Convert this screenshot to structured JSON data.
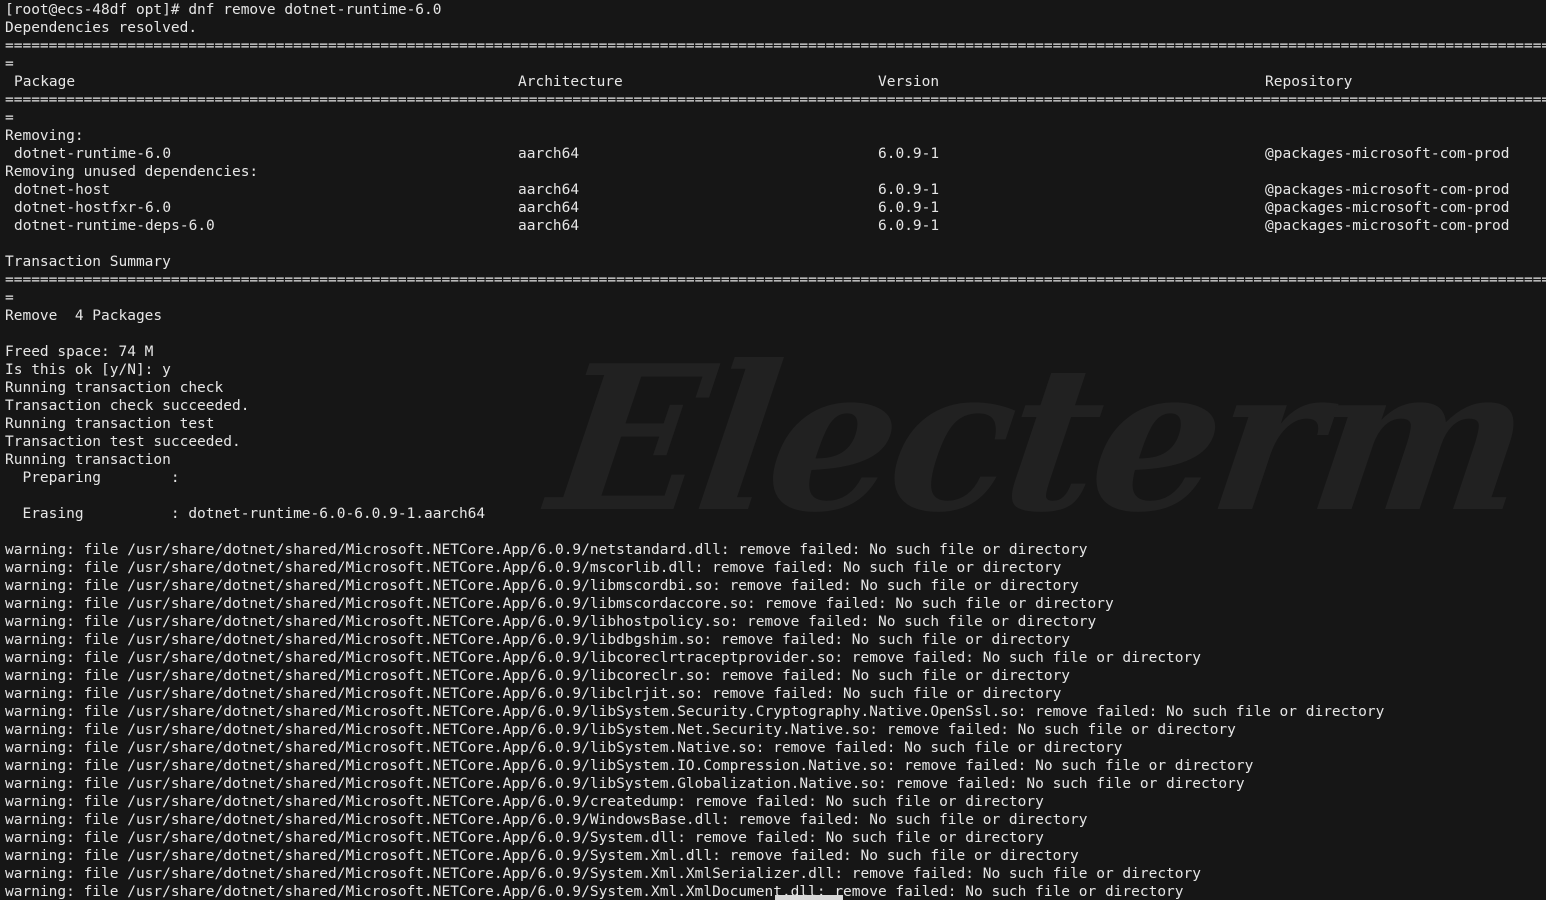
{
  "watermark": "Electerm",
  "lines_top": [
    "[root@ecs-48df opt]# dnf remove dotnet-runtime-6.0",
    "Dependencies resolved."
  ],
  "separator_char": "=",
  "separator_tail": "=",
  "table_header": {
    "package": "Package",
    "architecture": "Architecture",
    "version": "Version",
    "repository": "Repository"
  },
  "section_removing": "Removing:",
  "removing_rows": [
    {
      "package": "dotnet-runtime-6.0",
      "arch": "aarch64",
      "version": "6.0.9-1",
      "repo": "@packages-microsoft-com-prod"
    }
  ],
  "section_unused": "Removing unused dependencies:",
  "unused_rows": [
    {
      "package": "dotnet-host",
      "arch": "aarch64",
      "version": "6.0.9-1",
      "repo": "@packages-microsoft-com-prod"
    },
    {
      "package": "dotnet-hostfxr-6.0",
      "arch": "aarch64",
      "version": "6.0.9-1",
      "repo": "@packages-microsoft-com-prod"
    },
    {
      "package": "dotnet-runtime-deps-6.0",
      "arch": "aarch64",
      "version": "6.0.9-1",
      "repo": "@packages-microsoft-com-prod"
    }
  ],
  "summary_title": "Transaction Summary",
  "summary_remove": "Remove  4 Packages",
  "transaction_lines": [
    "Freed space: 74 M",
    "Is this ok [y/N]: y",
    "Running transaction check",
    "Transaction check succeeded.",
    "Running transaction test",
    "Transaction test succeeded.",
    "Running transaction",
    "  Preparing        :",
    "",
    "  Erasing          : dotnet-runtime-6.0-6.0.9-1.aarch64",
    ""
  ],
  "warnings": [
    "warning: file /usr/share/dotnet/shared/Microsoft.NETCore.App/6.0.9/netstandard.dll: remove failed: No such file or directory",
    "warning: file /usr/share/dotnet/shared/Microsoft.NETCore.App/6.0.9/mscorlib.dll: remove failed: No such file or directory",
    "warning: file /usr/share/dotnet/shared/Microsoft.NETCore.App/6.0.9/libmscordbi.so: remove failed: No such file or directory",
    "warning: file /usr/share/dotnet/shared/Microsoft.NETCore.App/6.0.9/libmscordaccore.so: remove failed: No such file or directory",
    "warning: file /usr/share/dotnet/shared/Microsoft.NETCore.App/6.0.9/libhostpolicy.so: remove failed: No such file or directory",
    "warning: file /usr/share/dotnet/shared/Microsoft.NETCore.App/6.0.9/libdbgshim.so: remove failed: No such file or directory",
    "warning: file /usr/share/dotnet/shared/Microsoft.NETCore.App/6.0.9/libcoreclrtraceptprovider.so: remove failed: No such file or directory",
    "warning: file /usr/share/dotnet/shared/Microsoft.NETCore.App/6.0.9/libcoreclr.so: remove failed: No such file or directory",
    "warning: file /usr/share/dotnet/shared/Microsoft.NETCore.App/6.0.9/libclrjit.so: remove failed: No such file or directory",
    "warning: file /usr/share/dotnet/shared/Microsoft.NETCore.App/6.0.9/libSystem.Security.Cryptography.Native.OpenSsl.so: remove failed: No such file or directory",
    "warning: file /usr/share/dotnet/shared/Microsoft.NETCore.App/6.0.9/libSystem.Net.Security.Native.so: remove failed: No such file or directory",
    "warning: file /usr/share/dotnet/shared/Microsoft.NETCore.App/6.0.9/libSystem.Native.so: remove failed: No such file or directory",
    "warning: file /usr/share/dotnet/shared/Microsoft.NETCore.App/6.0.9/libSystem.IO.Compression.Native.so: remove failed: No such file or directory",
    "warning: file /usr/share/dotnet/shared/Microsoft.NETCore.App/6.0.9/libSystem.Globalization.Native.so: remove failed: No such file or directory",
    "warning: file /usr/share/dotnet/shared/Microsoft.NETCore.App/6.0.9/createdump: remove failed: No such file or directory",
    "warning: file /usr/share/dotnet/shared/Microsoft.NETCore.App/6.0.9/WindowsBase.dll: remove failed: No such file or directory",
    "warning: file /usr/share/dotnet/shared/Microsoft.NETCore.App/6.0.9/System.dll: remove failed: No such file or directory",
    "warning: file /usr/share/dotnet/shared/Microsoft.NETCore.App/6.0.9/System.Xml.dll: remove failed: No such file or directory",
    "warning: file /usr/share/dotnet/shared/Microsoft.NETCore.App/6.0.9/System.Xml.XmlSerializer.dll: remove failed: No such file or directory",
    "warning: file /usr/share/dotnet/shared/Microsoft.NETCore.App/6.0.9/System.Xml.XmlDocument.dll: remove failed: No such file or directory"
  ]
}
